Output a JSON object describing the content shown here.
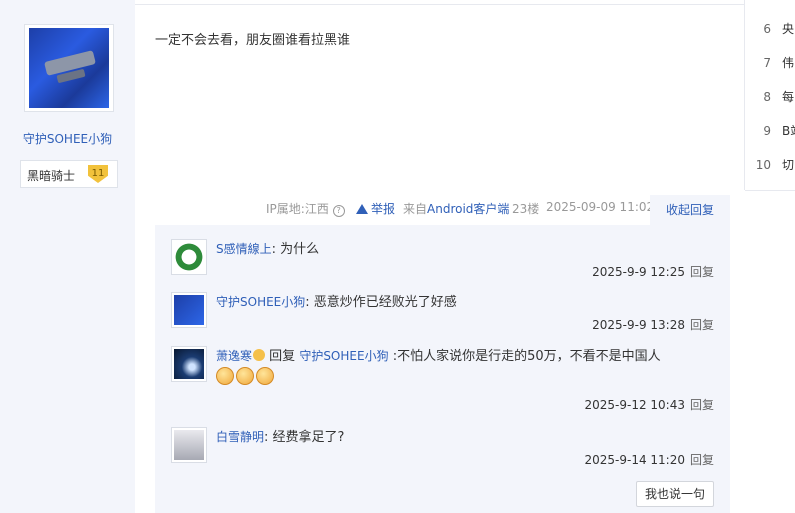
{
  "author": {
    "username": "守护SOHEE小狗",
    "badge_title": "黑暗骑士",
    "badge_level": "11",
    "avatar_icon": "spaceship-avatar"
  },
  "post": {
    "content": "一定不会去看，朋友圈谁看拉黑谁",
    "ip_label": "IP属地:江西",
    "report_label": "举报",
    "source_prefix": "来自",
    "source_client": "Android客户端",
    "floor": "23楼",
    "datetime": "2025-09-09 11:02",
    "collapse_label": "收起回复"
  },
  "comments": [
    {
      "name": "S感情線上",
      "text": "为什么",
      "time": "2025-9-9 12:25",
      "reply": "回复",
      "avatar_icon": "wreath-avatar"
    },
    {
      "name": "守护SOHEE小狗",
      "text": "恶意炒作已经败光了好感",
      "time": "2025-9-9 13:28",
      "reply": "回复",
      "avatar_icon": "spaceship-avatar"
    },
    {
      "name": "萧逸寒",
      "reply_prefix": "回复",
      "reply_to": "守护SOHEE小狗",
      "text": ":不怕人家说你是行走的50万，不看不是中国人",
      "time": "2025-9-12 10:43",
      "reply": "回复",
      "avatar_icon": "planet-avatar"
    },
    {
      "name": "白雪静明",
      "text": "经费拿足了?",
      "time": "2025-9-14 11:20",
      "reply": "回复",
      "avatar_icon": "anime-avatar"
    }
  ],
  "say_button": "我也说一句",
  "sidebar_ranks": [
    {
      "num": "6",
      "text": "央"
    },
    {
      "num": "7",
      "text": "伟"
    },
    {
      "num": "8",
      "text": "每"
    },
    {
      "num": "9",
      "text": "B站"
    },
    {
      "num": "10",
      "text": "切"
    }
  ],
  "colors": {
    "accent": "#3060b8",
    "panel_bg": "#f3f5fb"
  }
}
